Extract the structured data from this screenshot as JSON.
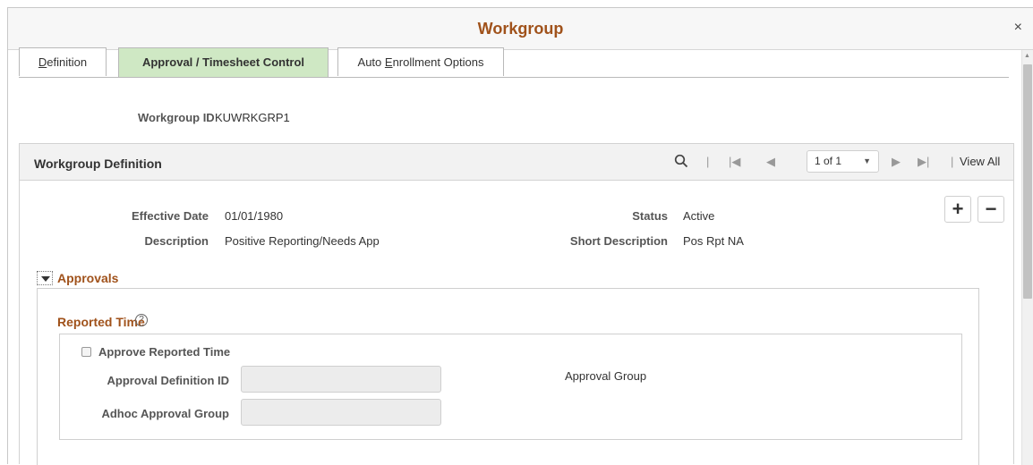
{
  "window": {
    "title": "Workgroup",
    "close_glyph": "×"
  },
  "tabs": [
    {
      "label": "Definition",
      "underline": "D",
      "rest": "efinition",
      "active": false
    },
    {
      "label": "Approval / Timesheet Control",
      "active": true
    },
    {
      "label": "Auto Enrollment Options",
      "before": "Auto ",
      "underline": "E",
      "rest": "nrollment Options",
      "active": false
    }
  ],
  "workgroup": {
    "id_label": "Workgroup ID",
    "id_value": "KUWRKGRP1"
  },
  "definition_grid": {
    "title": "Workgroup Definition",
    "pager_text": "1 of 1",
    "view_all": "View All",
    "effective_date_label": "Effective Date",
    "effective_date": "01/01/1980",
    "status_label": "Status",
    "status": "Active",
    "description_label": "Description",
    "description": "Positive Reporting/Needs App",
    "short_description_label": "Short Description",
    "short_description": "Pos Rpt NA",
    "add_glyph": "+",
    "remove_glyph": "−"
  },
  "approvals": {
    "title": "Approvals",
    "reported_time": {
      "title": "Reported Time",
      "help_glyph": "?",
      "approve_label": "Approve Reported Time",
      "approve_checked": false,
      "approval_definition_id_label": "Approval Definition ID",
      "approval_definition_id_value": "",
      "approval_group_label": "Approval Group",
      "adhoc_approval_group_label": "Adhoc Approval Group",
      "adhoc_approval_group_value": ""
    }
  },
  "icons": {
    "search": "search-icon",
    "first": "first-page-icon",
    "prev": "previous-page-icon",
    "next": "next-page-icon",
    "last": "last-page-icon",
    "dropdown": "dropdown-caret-icon",
    "collapse": "collapse-triangle-icon",
    "help": "help-icon"
  },
  "colors": {
    "accent": "#a0521b",
    "active_tab": "#cfe8c4"
  }
}
